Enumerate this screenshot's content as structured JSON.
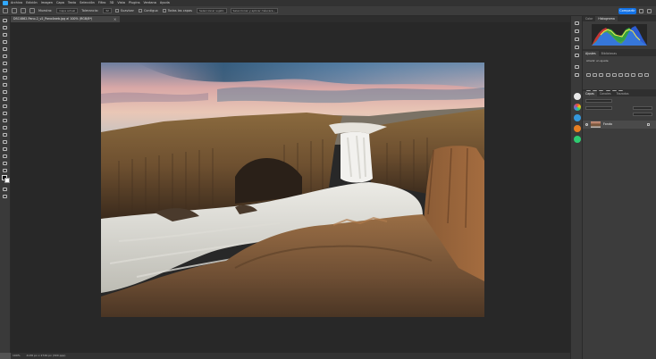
{
  "menu": [
    "Archivo",
    "Edición",
    "Imagen",
    "Capa",
    "Texto",
    "Selección",
    "Filtro",
    "3D",
    "Vista",
    "Plugins",
    "Ventana",
    "Ayuda"
  ],
  "options": {
    "sample_label": "Muestra:",
    "sample_value": "Capa actual",
    "tolerance_label": "Tolerancia:",
    "tolerance_value": "32",
    "antialias_label": "Suavizar",
    "contiguous_label": "Contiguo",
    "all_layers_label": "Todas las capas",
    "select_subject": "Seleccionar sujeto",
    "select_mask": "Seleccionar y aplicar máscara..."
  },
  "share_label": "Compartir",
  "document": {
    "tab_title": "DSC4862-Pano-2_v2_Pano4web.jpg al 100% (RGB/8*)",
    "close_glyph": "×"
  },
  "status": {
    "zoom": "100%",
    "info": "4136 px x 2749 px (300 ppp)"
  },
  "panels": {
    "top_tabs": [
      "Color",
      "Histograma"
    ],
    "adjust_tabs": [
      "Ajustes",
      "Bibliotecas"
    ],
    "adjust_label": "Añadir un ajuste",
    "layers_tabs": [
      "Capas",
      "Canales",
      "Trazados"
    ],
    "layer_name": "Fondo"
  },
  "colors": {
    "accent": "#1473e6",
    "ps_blue": "#31a8ff",
    "canvas_bg": "#282828",
    "ui_dark": "#323232"
  }
}
